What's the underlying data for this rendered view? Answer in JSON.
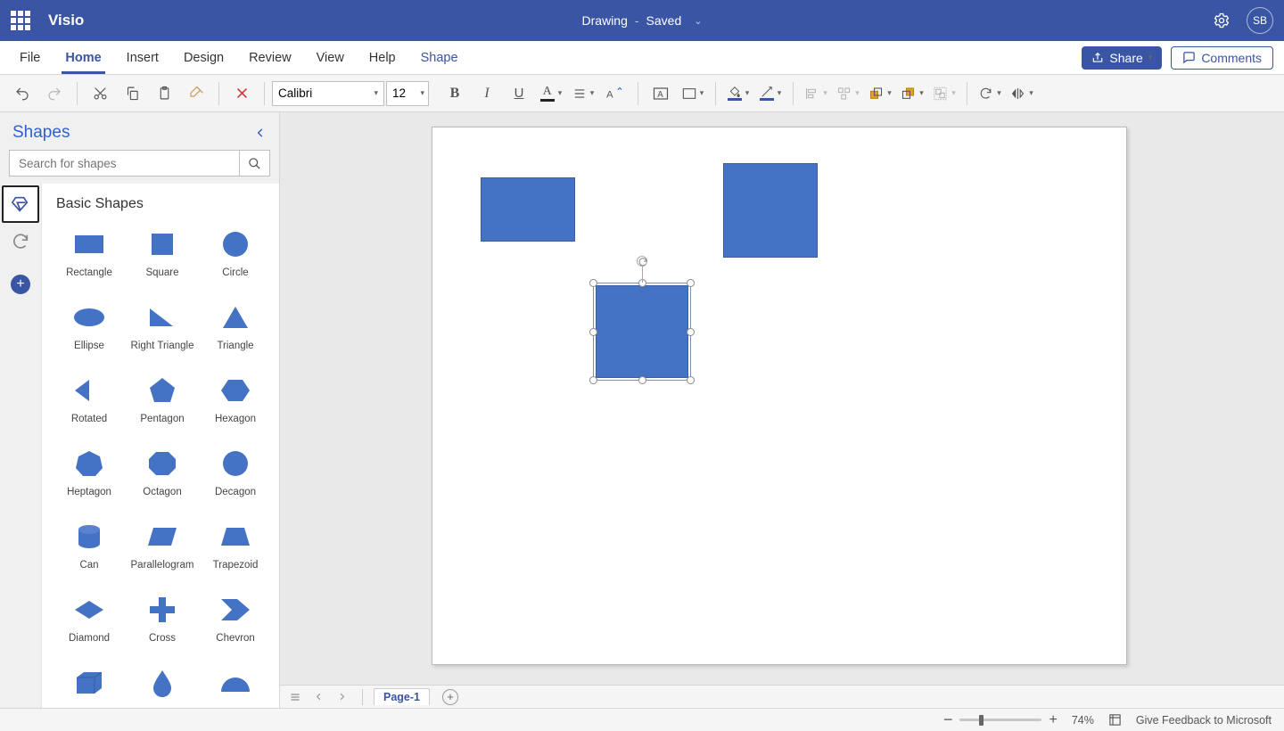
{
  "title": {
    "app": "Visio",
    "doc": "Drawing",
    "status": "Saved",
    "avatar": "SB"
  },
  "tabs": {
    "file": "File",
    "home": "Home",
    "insert": "Insert",
    "design": "Design",
    "review": "Review",
    "view": "View",
    "help": "Help",
    "shape": "Shape"
  },
  "ribbonRight": {
    "share": "Share",
    "comments": "Comments"
  },
  "toolbar": {
    "font": "Calibri",
    "size": "12"
  },
  "shapesPanel": {
    "title": "Shapes",
    "searchPlaceholder": "Search for shapes",
    "stencilTitle": "Basic Shapes",
    "shapes": [
      {
        "k": "rect",
        "label": "Rectangle"
      },
      {
        "k": "square",
        "label": "Square"
      },
      {
        "k": "circle",
        "label": "Circle"
      },
      {
        "k": "ellipse",
        "label": "Ellipse"
      },
      {
        "k": "rtri",
        "label": "Right Triangle"
      },
      {
        "k": "tri",
        "label": "Triangle"
      },
      {
        "k": "rot",
        "label": "Rotated"
      },
      {
        "k": "pent",
        "label": "Pentagon"
      },
      {
        "k": "hex",
        "label": "Hexagon"
      },
      {
        "k": "hept",
        "label": "Heptagon"
      },
      {
        "k": "oct",
        "label": "Octagon"
      },
      {
        "k": "dec",
        "label": "Decagon"
      },
      {
        "k": "can",
        "label": "Can"
      },
      {
        "k": "para",
        "label": "Parallelogram"
      },
      {
        "k": "trap",
        "label": "Trapezoid"
      },
      {
        "k": "diam",
        "label": "Diamond"
      },
      {
        "k": "cross",
        "label": "Cross"
      },
      {
        "k": "chevr",
        "label": "Chevron"
      },
      {
        "k": "cube",
        "label": ""
      },
      {
        "k": "drop",
        "label": ""
      },
      {
        "k": "halfc",
        "label": ""
      }
    ]
  },
  "pageTabs": {
    "page": "Page-1"
  },
  "status": {
    "zoom": "74%",
    "feedback": "Give Feedback to Microsoft"
  },
  "colors": {
    "shapeFill": "#4472c4",
    "accent": "#3955a3"
  }
}
